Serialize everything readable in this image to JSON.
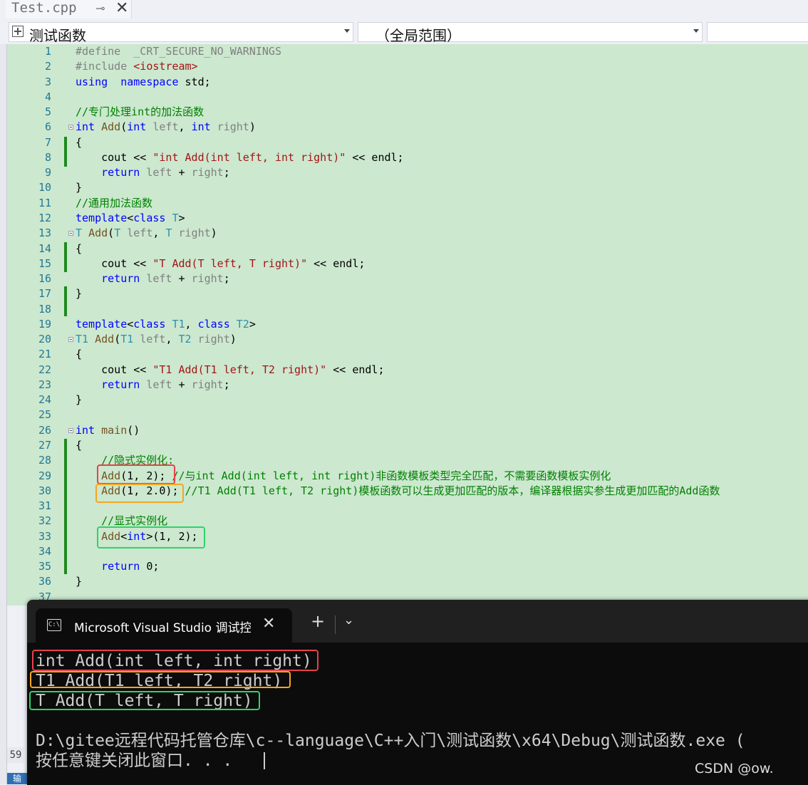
{
  "tab": {
    "filename": "Test.cpp",
    "pin_icon": "pin-icon",
    "close_icon": "close-icon"
  },
  "navbar": {
    "scope": "测试函数",
    "member": "（全局范围）",
    "extra": ""
  },
  "editor": {
    "lines": [
      {
        "n": "1",
        "segs": [
          [
            "pp",
            "#define  "
          ],
          [
            "pp",
            "_CRT_SECURE_NO_WARNINGS"
          ]
        ]
      },
      {
        "n": "2",
        "segs": [
          [
            "pp",
            "#include "
          ],
          [
            "str",
            "<iostream>"
          ]
        ]
      },
      {
        "n": "3",
        "segs": [
          [
            "kw",
            "using"
          ],
          [
            "",
            "  "
          ],
          [
            "kw",
            "namespace"
          ],
          [
            "",
            " std;"
          ]
        ]
      },
      {
        "n": "4",
        "segs": []
      },
      {
        "n": "5",
        "segs": [
          [
            "cm",
            "//专门处理int的加法函数"
          ]
        ]
      },
      {
        "n": "6",
        "fold": true,
        "segs": [
          [
            "kw",
            "int"
          ],
          [
            "",
            " "
          ],
          [
            "fn",
            "Add"
          ],
          [
            "",
            "("
          ],
          [
            "kw",
            "int"
          ],
          [
            "",
            " "
          ],
          [
            "pm",
            "left"
          ],
          [
            "",
            ", "
          ],
          [
            "kw",
            "int"
          ],
          [
            "",
            " "
          ],
          [
            "pm",
            "right"
          ],
          [
            "",
            ")"
          ]
        ]
      },
      {
        "n": "7",
        "segs": [
          [
            "",
            "{"
          ]
        ]
      },
      {
        "n": "8",
        "segs": [
          [
            "",
            "    cout << "
          ],
          [
            "str",
            "\"int Add(int left, int right)\""
          ],
          [
            "",
            " << endl;"
          ]
        ]
      },
      {
        "n": "9",
        "segs": [
          [
            "",
            "    "
          ],
          [
            "kw",
            "return"
          ],
          [
            "",
            " "
          ],
          [
            "pm",
            "left"
          ],
          [
            "",
            " + "
          ],
          [
            "pm",
            "right"
          ],
          [
            "",
            ";"
          ]
        ]
      },
      {
        "n": "10",
        "segs": [
          [
            "",
            "}"
          ]
        ]
      },
      {
        "n": "11",
        "segs": [
          [
            "cm",
            "//通用加法函数"
          ]
        ]
      },
      {
        "n": "12",
        "segs": [
          [
            "kw",
            "template"
          ],
          [
            "",
            "<"
          ],
          [
            "kw",
            "class"
          ],
          [
            "",
            " "
          ],
          [
            "tp",
            "T"
          ],
          [
            "",
            ">"
          ]
        ]
      },
      {
        "n": "13",
        "fold": true,
        "segs": [
          [
            "tp",
            "T"
          ],
          [
            "",
            " "
          ],
          [
            "fn",
            "Add"
          ],
          [
            "",
            "("
          ],
          [
            "tp",
            "T"
          ],
          [
            "",
            " "
          ],
          [
            "pm",
            "left"
          ],
          [
            "",
            ", "
          ],
          [
            "tp",
            "T"
          ],
          [
            "",
            " "
          ],
          [
            "pm",
            "right"
          ],
          [
            "",
            ")"
          ]
        ]
      },
      {
        "n": "14",
        "segs": [
          [
            "",
            "{"
          ]
        ]
      },
      {
        "n": "15",
        "segs": [
          [
            "",
            "    cout << "
          ],
          [
            "str",
            "\"T Add(T left, T right)\""
          ],
          [
            "",
            " << endl;"
          ]
        ]
      },
      {
        "n": "16",
        "segs": [
          [
            "",
            "    "
          ],
          [
            "kw",
            "return"
          ],
          [
            "",
            " "
          ],
          [
            "pm",
            "left"
          ],
          [
            "",
            " + "
          ],
          [
            "pm",
            "right"
          ],
          [
            "",
            ";"
          ]
        ]
      },
      {
        "n": "17",
        "segs": [
          [
            "",
            "}"
          ]
        ]
      },
      {
        "n": "18",
        "segs": []
      },
      {
        "n": "19",
        "segs": [
          [
            "kw",
            "template"
          ],
          [
            "",
            "<"
          ],
          [
            "kw",
            "class"
          ],
          [
            "",
            " "
          ],
          [
            "tp",
            "T1"
          ],
          [
            "",
            ", "
          ],
          [
            "kw",
            "class"
          ],
          [
            "",
            " "
          ],
          [
            "tp",
            "T2"
          ],
          [
            "",
            ">"
          ]
        ]
      },
      {
        "n": "20",
        "fold": true,
        "segs": [
          [
            "tp",
            "T1"
          ],
          [
            "",
            " "
          ],
          [
            "fn",
            "Add"
          ],
          [
            "",
            "("
          ],
          [
            "tp",
            "T1"
          ],
          [
            "",
            " "
          ],
          [
            "pm",
            "left"
          ],
          [
            "",
            ", "
          ],
          [
            "tp",
            "T2"
          ],
          [
            "",
            " "
          ],
          [
            "pm",
            "right"
          ],
          [
            "",
            ")"
          ]
        ]
      },
      {
        "n": "21",
        "segs": [
          [
            "",
            "{"
          ]
        ]
      },
      {
        "n": "22",
        "segs": [
          [
            "",
            "    cout << "
          ],
          [
            "str",
            "\"T1 Add(T1 left, T2 right)\""
          ],
          [
            "",
            " << endl;"
          ]
        ]
      },
      {
        "n": "23",
        "segs": [
          [
            "",
            "    "
          ],
          [
            "kw",
            "return"
          ],
          [
            "",
            " "
          ],
          [
            "pm",
            "left"
          ],
          [
            "",
            " + "
          ],
          [
            "pm",
            "right"
          ],
          [
            "",
            ";"
          ]
        ]
      },
      {
        "n": "24",
        "segs": [
          [
            "",
            "}"
          ]
        ]
      },
      {
        "n": "25",
        "segs": []
      },
      {
        "n": "26",
        "fold": true,
        "segs": [
          [
            "kw",
            "int"
          ],
          [
            "",
            " "
          ],
          [
            "fn",
            "main"
          ],
          [
            "",
            "()"
          ]
        ]
      },
      {
        "n": "27",
        "segs": [
          [
            "",
            "{"
          ]
        ]
      },
      {
        "n": "28",
        "segs": [
          [
            "",
            "    "
          ],
          [
            "cm",
            "//隐式实例化:"
          ]
        ]
      },
      {
        "n": "29",
        "segs": [
          [
            "",
            "    "
          ],
          [
            "fn",
            "Add"
          ],
          [
            "",
            "(1, 2); "
          ],
          [
            "cm",
            "//与int Add(int left, int right)非函数模板类型完全匹配，不需要函数模板实例化"
          ]
        ]
      },
      {
        "n": "30",
        "segs": [
          [
            "",
            "    "
          ],
          [
            "fn",
            "Add"
          ],
          [
            "",
            "(1, 2.0); "
          ],
          [
            "cm",
            "//T1 Add(T1 left, T2 right)模板函数可以生成更加匹配的版本，编译器根据实参生成更加匹配的Add函数"
          ]
        ]
      },
      {
        "n": "31",
        "segs": []
      },
      {
        "n": "32",
        "segs": [
          [
            "",
            "    "
          ],
          [
            "cm",
            "//显式实例化"
          ]
        ]
      },
      {
        "n": "33",
        "segs": [
          [
            "",
            "    "
          ],
          [
            "fn",
            "Add"
          ],
          [
            "",
            "<"
          ],
          [
            "kw",
            "int"
          ],
          [
            "",
            ">(1, 2);"
          ]
        ]
      },
      {
        "n": "34",
        "segs": []
      },
      {
        "n": "35",
        "segs": [
          [
            "",
            "    "
          ],
          [
            "kw",
            "return"
          ],
          [
            "",
            " 0;"
          ]
        ]
      },
      {
        "n": "36",
        "segs": [
          [
            "",
            "}"
          ]
        ]
      },
      {
        "n": "37",
        "segs": []
      }
    ],
    "gutter_line": "59",
    "bottom_tab_label": "输"
  },
  "terminal": {
    "title": "Microsoft Visual Studio 调试控",
    "icon": "terminal-icon",
    "output": [
      "int Add(int left, int right)",
      "T1 Add(T1 left, T2 right)",
      "T Add(T left, T right)",
      "",
      "D:\\gitee远程代码托管仓库\\c--language\\C++入门\\测试函数\\x64\\Debug\\测试函数.exe (",
      "按任意键关闭此窗口. . ."
    ]
  },
  "watermark": "CSDN @ow.",
  "colors": {
    "highlight_red": "#e8414a",
    "highlight_orange": "#f5a623",
    "highlight_green": "#2fd36a",
    "editor_bg": "#cce8cf"
  }
}
